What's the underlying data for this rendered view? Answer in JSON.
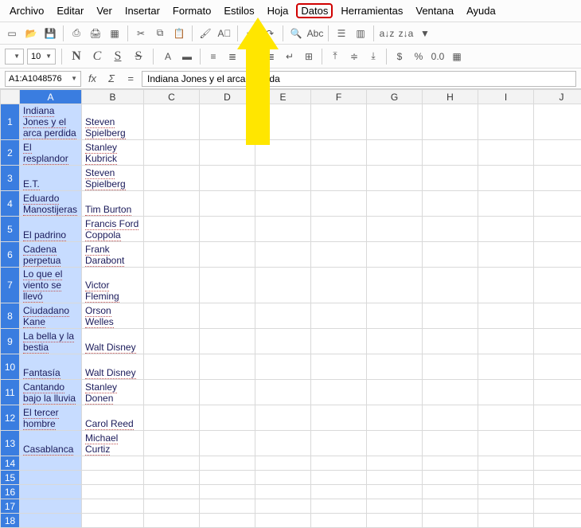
{
  "menu": [
    "Archivo",
    "Editar",
    "Ver",
    "Insertar",
    "Formato",
    "Estilos",
    "Hoja",
    "Datos",
    "Herramientas",
    "Ventana",
    "Ayuda"
  ],
  "highlighted_menu_index": 7,
  "toolbar_icons": [
    {
      "n": "new-icon",
      "g": "▭"
    },
    {
      "n": "open-icon",
      "g": "📂"
    },
    {
      "n": "save-icon",
      "g": "💾"
    },
    {
      "n": "sep"
    },
    {
      "n": "export-pdf-icon",
      "g": "⎙"
    },
    {
      "n": "print-icon",
      "g": "🖨"
    },
    {
      "n": "print-preview-icon",
      "g": "▦"
    },
    {
      "n": "sep"
    },
    {
      "n": "cut-icon",
      "g": "✂"
    },
    {
      "n": "copy-icon",
      "g": "⧉"
    },
    {
      "n": "paste-icon",
      "g": "📋"
    },
    {
      "n": "sep"
    },
    {
      "n": "clone-fmt-icon",
      "g": "🖌"
    },
    {
      "n": "clear-fmt-icon",
      "g": "A⃠"
    },
    {
      "n": "sep"
    },
    {
      "n": "undo-icon",
      "g": "↶"
    },
    {
      "n": "redo-icon",
      "g": "↷"
    },
    {
      "n": "sep"
    },
    {
      "n": "find-icon",
      "g": "🔍"
    },
    {
      "n": "spellcheck-icon",
      "g": "Abc"
    },
    {
      "n": "sep"
    },
    {
      "n": "row-icon",
      "g": "☰"
    },
    {
      "n": "col-icon",
      "g": "▥"
    },
    {
      "n": "sep"
    },
    {
      "n": "sort-asc-icon",
      "g": "a↓z"
    },
    {
      "n": "sort-desc-icon",
      "g": "z↓a"
    },
    {
      "n": "autofilter-icon",
      "g": "▼"
    }
  ],
  "fontSize": "10",
  "fontStyleButtons": {
    "bold": "N",
    "italic": "C",
    "underline": "S",
    "strike": "S"
  },
  "fmt_icons": [
    {
      "n": "font-color-icon",
      "g": "A"
    },
    {
      "n": "highlight-color-icon",
      "g": "▬"
    },
    {
      "n": "sep"
    },
    {
      "n": "align-left-icon",
      "g": "≡"
    },
    {
      "n": "align-center-icon",
      "g": "≣"
    },
    {
      "n": "align-right-icon",
      "g": "≡"
    },
    {
      "n": "align-justify-icon",
      "g": "≣"
    },
    {
      "n": "wrap-text-icon",
      "g": "↵"
    },
    {
      "n": "merge-cells-icon",
      "g": "⊞"
    },
    {
      "n": "sep"
    },
    {
      "n": "valign-top-icon",
      "g": "⤒"
    },
    {
      "n": "valign-middle-icon",
      "g": "≑"
    },
    {
      "n": "valign-bottom-icon",
      "g": "⤓"
    },
    {
      "n": "sep"
    },
    {
      "n": "currency-icon",
      "g": "$"
    },
    {
      "n": "percent-icon",
      "g": "%"
    },
    {
      "n": "number-icon",
      "g": "0.0"
    },
    {
      "n": "date-icon",
      "g": "▦"
    }
  ],
  "cellRef": "A1:A1048576",
  "formulaText": "Indiana Jones y el arca perdida",
  "columns": [
    "A",
    "B",
    "C",
    "D",
    "E",
    "F",
    "G",
    "H",
    "I",
    "J"
  ],
  "rows": [
    {
      "n": 1,
      "a": "Indiana Jones y el arca perdida",
      "b": "Steven Spielberg"
    },
    {
      "n": 2,
      "a": "El resplandor",
      "b": "Stanley Kubrick"
    },
    {
      "n": 3,
      "a": "E.T.",
      "b": "Steven Spielberg"
    },
    {
      "n": 4,
      "a": "Eduardo Manostijeras",
      "b": "Tim Burton"
    },
    {
      "n": 5,
      "a": "El padrino",
      "b": "Francis Ford Coppola"
    },
    {
      "n": 6,
      "a": "Cadena perpetua",
      "b": "Frank Darabont"
    },
    {
      "n": 7,
      "a": "Lo que el viento se llevó",
      "b": "Victor Fleming"
    },
    {
      "n": 8,
      "a": "Ciudadano Kane",
      "b": "Orson Welles"
    },
    {
      "n": 9,
      "a": "La bella y la bestia",
      "b": "Walt Disney"
    },
    {
      "n": 10,
      "a": "Fantasía",
      "b": "Walt Disney"
    },
    {
      "n": 11,
      "a": "Cantando bajo la lluvia",
      "b": "Stanley Donen"
    },
    {
      "n": 12,
      "a": "El tercer hombre",
      "b": "Carol Reed"
    },
    {
      "n": 13,
      "a": "Casablanca",
      "b": "Michael Curtiz"
    },
    {
      "n": 14,
      "a": "",
      "b": ""
    },
    {
      "n": 15,
      "a": "",
      "b": ""
    },
    {
      "n": 16,
      "a": "",
      "b": ""
    },
    {
      "n": 17,
      "a": "",
      "b": ""
    },
    {
      "n": 18,
      "a": "",
      "b": ""
    }
  ]
}
